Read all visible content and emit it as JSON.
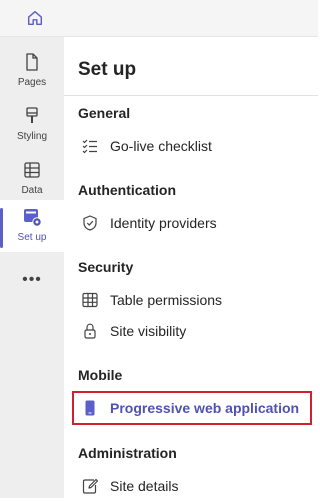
{
  "rail": {
    "items": [
      {
        "label": "Pages",
        "icon": "page-icon"
      },
      {
        "label": "Styling",
        "icon": "paintbrush-icon"
      },
      {
        "label": "Data",
        "icon": "table-icon"
      },
      {
        "label": "Set up",
        "icon": "setup-gear-icon"
      }
    ],
    "more_label": "•••"
  },
  "panel": {
    "title": "Set up",
    "sections": [
      {
        "heading": "General",
        "items": [
          {
            "label": "Go-live checklist",
            "icon": "checklist-icon"
          }
        ]
      },
      {
        "heading": "Authentication",
        "items": [
          {
            "label": "Identity providers",
            "icon": "shield-icon"
          }
        ]
      },
      {
        "heading": "Security",
        "items": [
          {
            "label": "Table permissions",
            "icon": "table-icon"
          },
          {
            "label": "Site visibility",
            "icon": "lock-icon"
          }
        ]
      },
      {
        "heading": "Mobile",
        "items": [
          {
            "label": "Progressive web application",
            "icon": "phone-icon",
            "selected": true
          }
        ]
      },
      {
        "heading": "Administration",
        "items": [
          {
            "label": "Site details",
            "icon": "edit-icon"
          }
        ]
      }
    ]
  },
  "colors": {
    "accent": "#5b5fc7",
    "selected_text": "#4f52b2",
    "highlight_border": "#d1202f"
  }
}
